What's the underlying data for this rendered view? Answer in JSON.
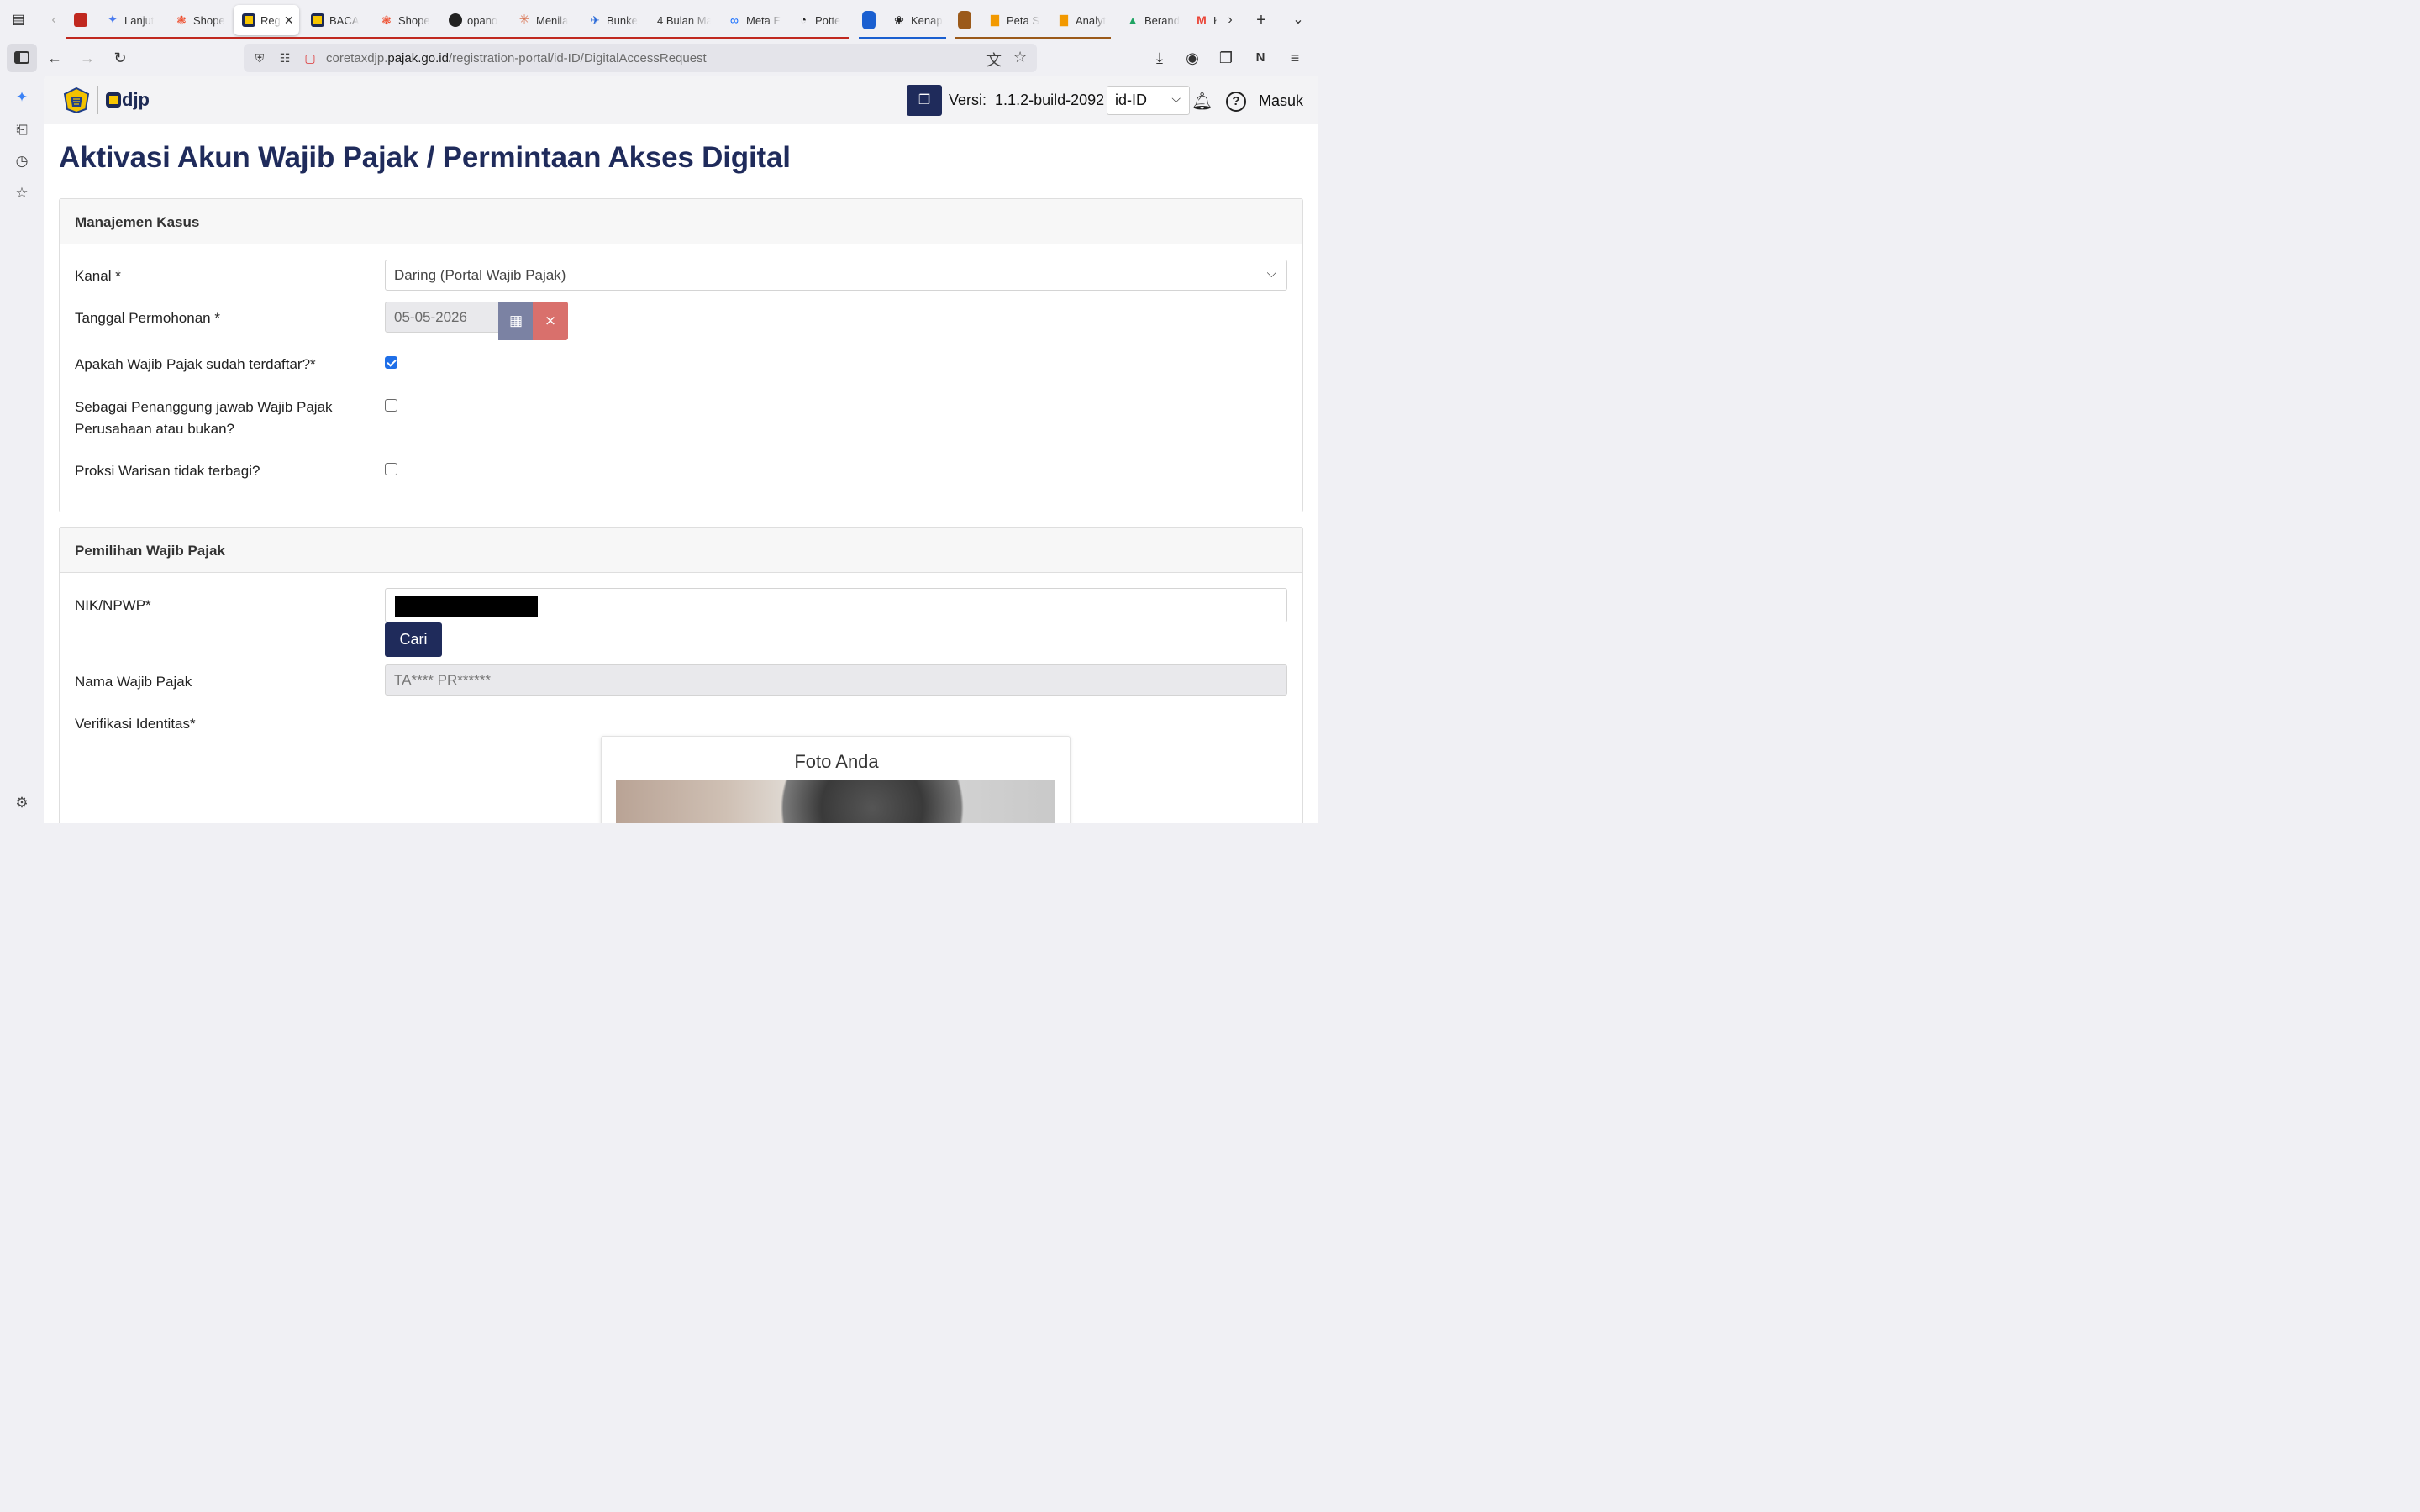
{
  "browser": {
    "tabs": [
      {
        "label": "",
        "icon": "red-square-icon",
        "color": "#c0281f"
      },
      {
        "label": "Lanjut",
        "icon": "gemini-sparkle-icon",
        "color": "#4a7cf0"
      },
      {
        "label": "Shope",
        "icon": "shopee-icon",
        "color": "#ee4d2d"
      },
      {
        "label": "Reg",
        "icon": "coretax-icon",
        "color": "#1d2a55",
        "active": true
      },
      {
        "label": "BACA",
        "icon": "coretax-icon",
        "color": "#1d2a55"
      },
      {
        "label": "Shope",
        "icon": "shopee-icon",
        "color": "#ee4d2d"
      },
      {
        "label": "opano",
        "icon": "github-icon",
        "color": "#222222"
      },
      {
        "label": "Menila",
        "icon": "claude-icon",
        "color": "#d97757"
      },
      {
        "label": "Bunke",
        "icon": "bunker-icon",
        "color": "#2a6ad8"
      },
      {
        "label": "4 Bulan Ma",
        "icon": "",
        "color": ""
      },
      {
        "label": "Meta E",
        "icon": "meta-icon",
        "color": "#0866ff"
      },
      {
        "label": "Potte",
        "icon": "potter-icon",
        "color": "#222222"
      },
      {
        "label": "",
        "icon": "blue-square-icon",
        "color": "#1a5fd0"
      },
      {
        "label": "Kenap",
        "icon": "openai-icon",
        "color": "#222222"
      },
      {
        "label": "",
        "icon": "brown-square-icon",
        "color": "#9b5a1a"
      },
      {
        "label": "Peta S",
        "icon": "analytics-icon",
        "color": "#f29900"
      },
      {
        "label": "Analyt",
        "icon": "analytics-icon",
        "color": "#f29900"
      },
      {
        "label": "Berand",
        "icon": "drive-icon",
        "color": "#1fa463"
      },
      {
        "label": "K",
        "icon": "gmail-icon",
        "color": "#ea4335"
      }
    ],
    "url_prefix": "coretaxdjp.",
    "url_domain": "pajak.go.id",
    "url_path": "/registration-portal/id-ID/DigitalAccessRequest"
  },
  "header": {
    "logo_text": "djp",
    "versi_label": "Versi:",
    "versi_value": "1.1.2-build-2092",
    "language": "id-ID",
    "login_label": "Masuk"
  },
  "page": {
    "title": "Aktivasi Akun Wajib Pajak / Permintaan Akses Digital"
  },
  "manajemen_kasus": {
    "heading": "Manajemen Kasus",
    "kanal_label": "Kanal *",
    "kanal_value": "Daring (Portal Wajib Pajak)",
    "tanggal_label": "Tanggal Permohonan *",
    "tanggal_value": "05-05-2026",
    "terdaftar_label": "Apakah Wajib Pajak sudah terdaftar?*",
    "terdaftar_checked": true,
    "penanggung_label_1": "Sebagai Penanggung jawab Wajib Pajak",
    "penanggung_label_2": "Perusahaan atau bukan?",
    "penanggung_checked": false,
    "proksi_label": "Proksi Warisan tidak terbagi?",
    "proksi_checked": false
  },
  "pemilihan_wajib_pajak": {
    "heading": "Pemilihan Wajib Pajak",
    "nik_label": "NIK/NPWP*",
    "cari_label": "Cari",
    "nama_label": "Nama Wajib Pajak",
    "nama_value": "TA**** PR******",
    "verifikasi_label": "Verifikasi Identitas*",
    "foto_title": "Foto Anda"
  }
}
